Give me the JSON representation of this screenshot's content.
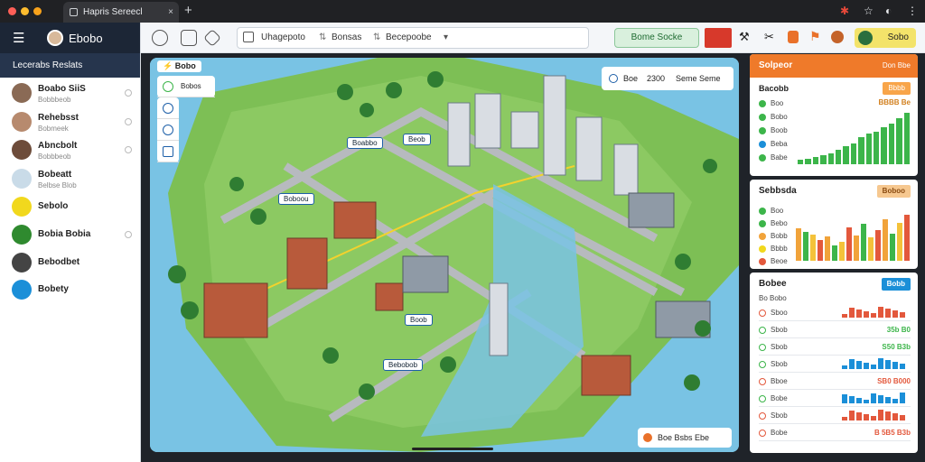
{
  "browser": {
    "tab_title": "Hapris Sereecl",
    "new_tab": "+",
    "close": "×",
    "colors": {
      "red": "#ff5f57",
      "orange": "#febc2e",
      "amber": "#f7a21b"
    }
  },
  "sidebar": {
    "app_title": "Ebobo",
    "section_header": "Lecerabs Reslats",
    "items": [
      {
        "label": "Boabo SiiS",
        "sub": "Bobbbeob",
        "avatar": "person"
      },
      {
        "label": "Rehebsst",
        "sub": "Bobmeek",
        "avatar": "person"
      },
      {
        "label": "Abncbolt",
        "sub": "Bobbbeob",
        "avatar": "person"
      },
      {
        "label": "Bobeatt",
        "sub": "Belbse Blob",
        "avatar": "gear"
      },
      {
        "label": "Sebolo",
        "sub": "",
        "avatar": "yellow"
      },
      {
        "label": "Bobia Bobia",
        "sub": "",
        "avatar": "green"
      },
      {
        "label": "Bebodbet",
        "sub": "",
        "avatar": "dark"
      },
      {
        "label": "Bobety",
        "sub": "",
        "avatar": "blue"
      }
    ]
  },
  "toolbar": {
    "filter_1": "Uhagepoto",
    "filter_2": "Bonsas",
    "filter_3": "Becepoobe",
    "green_button": "Bome Socke",
    "yellow_button": "Sobo"
  },
  "map": {
    "title": "Bobo",
    "legend_left": "Bobos",
    "legend_right": "Seme Seme",
    "legend_count": "2300",
    "legend_code": "Boe",
    "labels": [
      "Boabbo",
      "Beob",
      "Boboou",
      "Boob",
      "Bebobob"
    ],
    "bottom_chip": "Boe Bsbs Ebe"
  },
  "panels": {
    "panel1": {
      "title": "Solpeor",
      "header_badge": "Don Bbe",
      "subtitle": "Bacobb",
      "badge": "Bbbb",
      "badge2": "BBBB Be",
      "rows": [
        "Boo",
        "Bobo",
        "Boob",
        "Beba",
        "Babe"
      ],
      "bars": [
        8,
        10,
        14,
        18,
        20,
        28,
        34,
        40,
        52,
        58,
        62,
        70,
        78,
        88,
        98
      ],
      "color": "#3cb54a"
    },
    "panel2": {
      "title": "Sebbsda",
      "badge": "Boboo",
      "rows": [
        "Boo",
        "Bebo",
        "Bobb",
        "Bbbb",
        "Beoe"
      ],
      "bars": [
        62,
        56,
        50,
        40,
        46,
        30,
        36,
        64,
        48,
        70,
        44,
        58,
        80,
        52,
        72,
        88
      ],
      "color": "#f1a33a"
    },
    "panel3": {
      "title": "Bobee",
      "badge": "Bobb",
      "subtitle": "Bo Bobo",
      "rows": [
        {
          "label": "Sboo",
          "value": "",
          "color": "#e3583c"
        },
        {
          "label": "Sbob",
          "value": "35b B0",
          "color": "#3cb54a"
        },
        {
          "label": "Sbob",
          "value": "S50 B3b",
          "color": "#3cb54a"
        },
        {
          "label": "Sbob",
          "value": "",
          "color": "#3cb54a"
        },
        {
          "label": "Bboe",
          "value": "SB0 B000",
          "color": "#e3583c"
        },
        {
          "label": "Bobe",
          "value": "",
          "color": "#3cb54a"
        },
        {
          "label": "Sbob",
          "value": "",
          "color": "#e3583c"
        },
        {
          "label": "Bobe",
          "value": "B 5B5 B3b",
          "color": "#e3583c"
        }
      ]
    }
  }
}
